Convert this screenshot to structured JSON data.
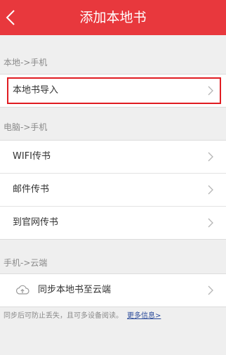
{
  "header": {
    "title": "添加本地书"
  },
  "sections": {
    "local_to_phone": "本地->手机",
    "pc_to_phone": "电脑->手机",
    "phone_to_cloud": "手机->云端"
  },
  "local_group": {
    "import_label": "本地书导入"
  },
  "pc_group": {
    "wifi_label": "WIFI传书",
    "email_label": "邮件传书",
    "website_label": "到官网传书"
  },
  "cloud_group": {
    "sync_label": "同步本地书至云端"
  },
  "footnote": {
    "text": "同步后可防止丢失，且可多设备阅读。",
    "link": "更多信息>"
  },
  "colors": {
    "brand": "#e8383d",
    "highlight": "#e01c22"
  }
}
